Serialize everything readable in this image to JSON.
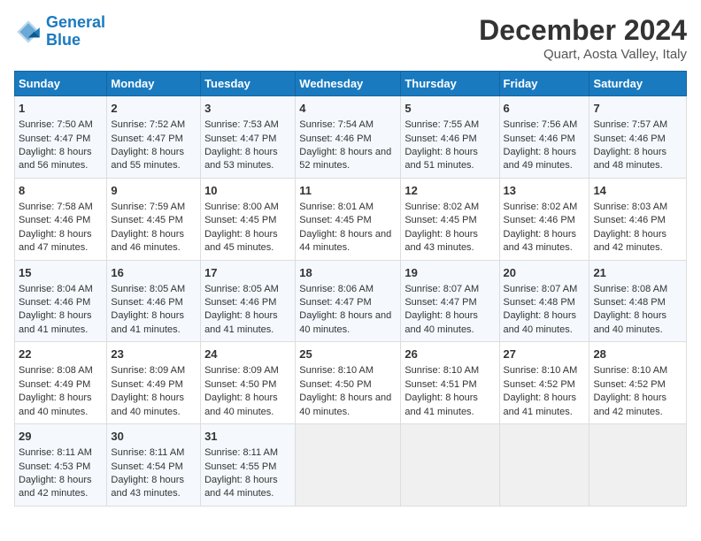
{
  "header": {
    "logo_line1": "General",
    "logo_line2": "Blue",
    "main_title": "December 2024",
    "subtitle": "Quart, Aosta Valley, Italy"
  },
  "days_of_week": [
    "Sunday",
    "Monday",
    "Tuesday",
    "Wednesday",
    "Thursday",
    "Friday",
    "Saturday"
  ],
  "weeks": [
    [
      {
        "day": "1",
        "sunrise": "Sunrise: 7:50 AM",
        "sunset": "Sunset: 4:47 PM",
        "daylight": "Daylight: 8 hours and 56 minutes."
      },
      {
        "day": "2",
        "sunrise": "Sunrise: 7:52 AM",
        "sunset": "Sunset: 4:47 PM",
        "daylight": "Daylight: 8 hours and 55 minutes."
      },
      {
        "day": "3",
        "sunrise": "Sunrise: 7:53 AM",
        "sunset": "Sunset: 4:47 PM",
        "daylight": "Daylight: 8 hours and 53 minutes."
      },
      {
        "day": "4",
        "sunrise": "Sunrise: 7:54 AM",
        "sunset": "Sunset: 4:46 PM",
        "daylight": "Daylight: 8 hours and 52 minutes."
      },
      {
        "day": "5",
        "sunrise": "Sunrise: 7:55 AM",
        "sunset": "Sunset: 4:46 PM",
        "daylight": "Daylight: 8 hours and 51 minutes."
      },
      {
        "day": "6",
        "sunrise": "Sunrise: 7:56 AM",
        "sunset": "Sunset: 4:46 PM",
        "daylight": "Daylight: 8 hours and 49 minutes."
      },
      {
        "day": "7",
        "sunrise": "Sunrise: 7:57 AM",
        "sunset": "Sunset: 4:46 PM",
        "daylight": "Daylight: 8 hours and 48 minutes."
      }
    ],
    [
      {
        "day": "8",
        "sunrise": "Sunrise: 7:58 AM",
        "sunset": "Sunset: 4:46 PM",
        "daylight": "Daylight: 8 hours and 47 minutes."
      },
      {
        "day": "9",
        "sunrise": "Sunrise: 7:59 AM",
        "sunset": "Sunset: 4:45 PM",
        "daylight": "Daylight: 8 hours and 46 minutes."
      },
      {
        "day": "10",
        "sunrise": "Sunrise: 8:00 AM",
        "sunset": "Sunset: 4:45 PM",
        "daylight": "Daylight: 8 hours and 45 minutes."
      },
      {
        "day": "11",
        "sunrise": "Sunrise: 8:01 AM",
        "sunset": "Sunset: 4:45 PM",
        "daylight": "Daylight: 8 hours and 44 minutes."
      },
      {
        "day": "12",
        "sunrise": "Sunrise: 8:02 AM",
        "sunset": "Sunset: 4:45 PM",
        "daylight": "Daylight: 8 hours and 43 minutes."
      },
      {
        "day": "13",
        "sunrise": "Sunrise: 8:02 AM",
        "sunset": "Sunset: 4:46 PM",
        "daylight": "Daylight: 8 hours and 43 minutes."
      },
      {
        "day": "14",
        "sunrise": "Sunrise: 8:03 AM",
        "sunset": "Sunset: 4:46 PM",
        "daylight": "Daylight: 8 hours and 42 minutes."
      }
    ],
    [
      {
        "day": "15",
        "sunrise": "Sunrise: 8:04 AM",
        "sunset": "Sunset: 4:46 PM",
        "daylight": "Daylight: 8 hours and 41 minutes."
      },
      {
        "day": "16",
        "sunrise": "Sunrise: 8:05 AM",
        "sunset": "Sunset: 4:46 PM",
        "daylight": "Daylight: 8 hours and 41 minutes."
      },
      {
        "day": "17",
        "sunrise": "Sunrise: 8:05 AM",
        "sunset": "Sunset: 4:46 PM",
        "daylight": "Daylight: 8 hours and 41 minutes."
      },
      {
        "day": "18",
        "sunrise": "Sunrise: 8:06 AM",
        "sunset": "Sunset: 4:47 PM",
        "daylight": "Daylight: 8 hours and 40 minutes."
      },
      {
        "day": "19",
        "sunrise": "Sunrise: 8:07 AM",
        "sunset": "Sunset: 4:47 PM",
        "daylight": "Daylight: 8 hours and 40 minutes."
      },
      {
        "day": "20",
        "sunrise": "Sunrise: 8:07 AM",
        "sunset": "Sunset: 4:48 PM",
        "daylight": "Daylight: 8 hours and 40 minutes."
      },
      {
        "day": "21",
        "sunrise": "Sunrise: 8:08 AM",
        "sunset": "Sunset: 4:48 PM",
        "daylight": "Daylight: 8 hours and 40 minutes."
      }
    ],
    [
      {
        "day": "22",
        "sunrise": "Sunrise: 8:08 AM",
        "sunset": "Sunset: 4:49 PM",
        "daylight": "Daylight: 8 hours and 40 minutes."
      },
      {
        "day": "23",
        "sunrise": "Sunrise: 8:09 AM",
        "sunset": "Sunset: 4:49 PM",
        "daylight": "Daylight: 8 hours and 40 minutes."
      },
      {
        "day": "24",
        "sunrise": "Sunrise: 8:09 AM",
        "sunset": "Sunset: 4:50 PM",
        "daylight": "Daylight: 8 hours and 40 minutes."
      },
      {
        "day": "25",
        "sunrise": "Sunrise: 8:10 AM",
        "sunset": "Sunset: 4:50 PM",
        "daylight": "Daylight: 8 hours and 40 minutes."
      },
      {
        "day": "26",
        "sunrise": "Sunrise: 8:10 AM",
        "sunset": "Sunset: 4:51 PM",
        "daylight": "Daylight: 8 hours and 41 minutes."
      },
      {
        "day": "27",
        "sunrise": "Sunrise: 8:10 AM",
        "sunset": "Sunset: 4:52 PM",
        "daylight": "Daylight: 8 hours and 41 minutes."
      },
      {
        "day": "28",
        "sunrise": "Sunrise: 8:10 AM",
        "sunset": "Sunset: 4:52 PM",
        "daylight": "Daylight: 8 hours and 42 minutes."
      }
    ],
    [
      {
        "day": "29",
        "sunrise": "Sunrise: 8:11 AM",
        "sunset": "Sunset: 4:53 PM",
        "daylight": "Daylight: 8 hours and 42 minutes."
      },
      {
        "day": "30",
        "sunrise": "Sunrise: 8:11 AM",
        "sunset": "Sunset: 4:54 PM",
        "daylight": "Daylight: 8 hours and 43 minutes."
      },
      {
        "day": "31",
        "sunrise": "Sunrise: 8:11 AM",
        "sunset": "Sunset: 4:55 PM",
        "daylight": "Daylight: 8 hours and 44 minutes."
      },
      null,
      null,
      null,
      null
    ]
  ]
}
